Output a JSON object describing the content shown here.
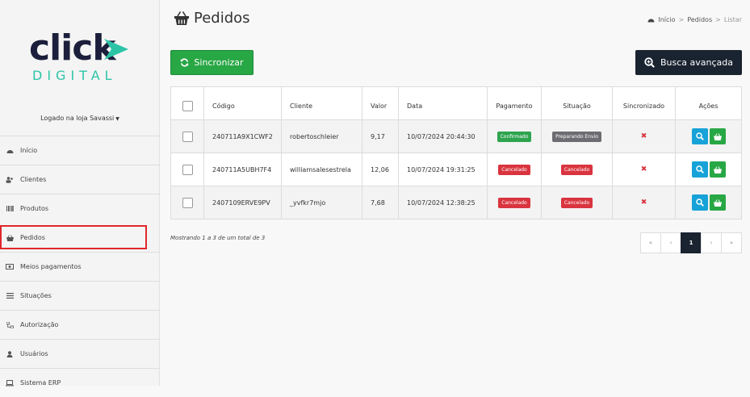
{
  "brand": {
    "logo_word": "click",
    "logo_sub": "DIGITAL",
    "colors": {
      "navy": "#1b1f3b",
      "teal": "#2cc4a7"
    }
  },
  "sidebar": {
    "user_label": "Logado na loja Savassi",
    "items": [
      {
        "label": "Início",
        "icon": "dashboard-icon"
      },
      {
        "label": "Clientes",
        "icon": "users-icon"
      },
      {
        "label": "Produtos",
        "icon": "barcode-icon"
      },
      {
        "label": "Pedidos",
        "icon": "basket-icon"
      },
      {
        "label": "Meios pagamentos",
        "icon": "money-icon"
      },
      {
        "label": "Situações",
        "icon": "list-icon"
      },
      {
        "label": "Autorização",
        "icon": "sitemap-icon"
      },
      {
        "label": "Usuários",
        "icon": "user-icon"
      },
      {
        "label": "Sistema ERP",
        "icon": "laptop-icon"
      }
    ]
  },
  "header": {
    "title": "Pedidos",
    "breadcrumb": {
      "home": "Início",
      "section": "Pedidos",
      "current": "Listar"
    }
  },
  "toolbar": {
    "sync_label": "Sincronizar",
    "search_label": "Busca avançada"
  },
  "table": {
    "headers": [
      "Código",
      "Cliente",
      "Valor",
      "Data",
      "Pagamento",
      "Situação",
      "Sincronizado",
      "Ações"
    ],
    "rows": [
      {
        "code": "240711A9X1CWF2",
        "client": "robertoschleier",
        "value": "9,17",
        "date": "10/07/2024 20:44:30",
        "payment": "Confirmado",
        "status": "Preparando Envio"
      },
      {
        "code": "240711A5UBH7F4",
        "client": "williamsalesestrela",
        "value": "12,06",
        "date": "10/07/2024 19:31:25",
        "payment": "Cancelado",
        "status": "Cancelado"
      },
      {
        "code": "2407109ERVE9PV",
        "client": "_yvfkr7mjo",
        "value": "7,68",
        "date": "10/07/2024 12:38:25",
        "payment": "Cancelado",
        "status": "Cancelado"
      }
    ]
  },
  "footer": {
    "showing": "Mostrando 1 a 3 de um total de 3"
  },
  "pagination": {
    "first": "«",
    "prev": "‹",
    "current": "1",
    "next": "›",
    "last": "»"
  }
}
